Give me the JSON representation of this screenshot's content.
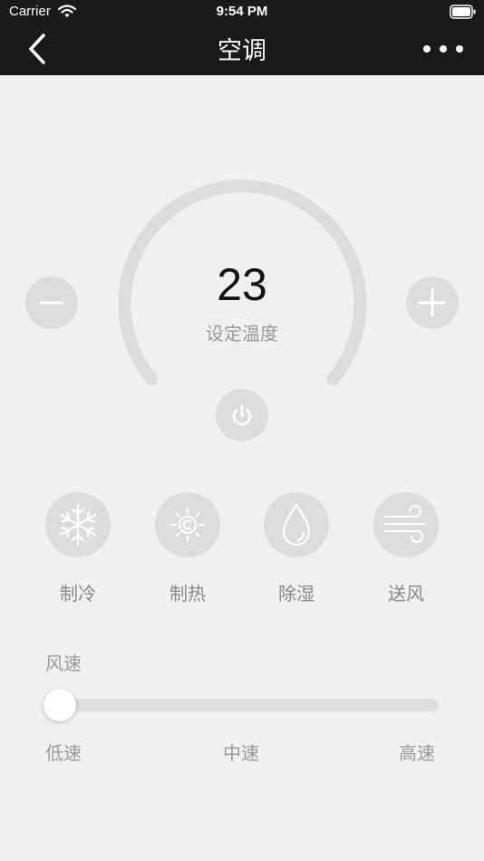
{
  "status_bar": {
    "carrier": "Carrier",
    "time": "9:54 PM"
  },
  "nav": {
    "title": "空调",
    "back_icon": "chevron-left-icon",
    "more_icon": "more-dots-icon"
  },
  "thermostat": {
    "temperature": "23",
    "label": "设定温度",
    "minus_icon": "minus-icon",
    "plus_icon": "plus-icon",
    "power_icon": "power-icon"
  },
  "modes": [
    {
      "label": "制冷",
      "icon": "snowflake-icon"
    },
    {
      "label": "制热",
      "icon": "sun-icon"
    },
    {
      "label": "除湿",
      "icon": "water-drop-icon"
    },
    {
      "label": "送风",
      "icon": "wind-icon"
    }
  ],
  "fan_speed": {
    "title": "风速",
    "level": 0,
    "labels": [
      "低速",
      "中速",
      "高速"
    ]
  },
  "colors": {
    "nav_background": "#1a1a1a",
    "page_background": "#f0f0f0",
    "button_gray": "#dcdcdc"
  }
}
